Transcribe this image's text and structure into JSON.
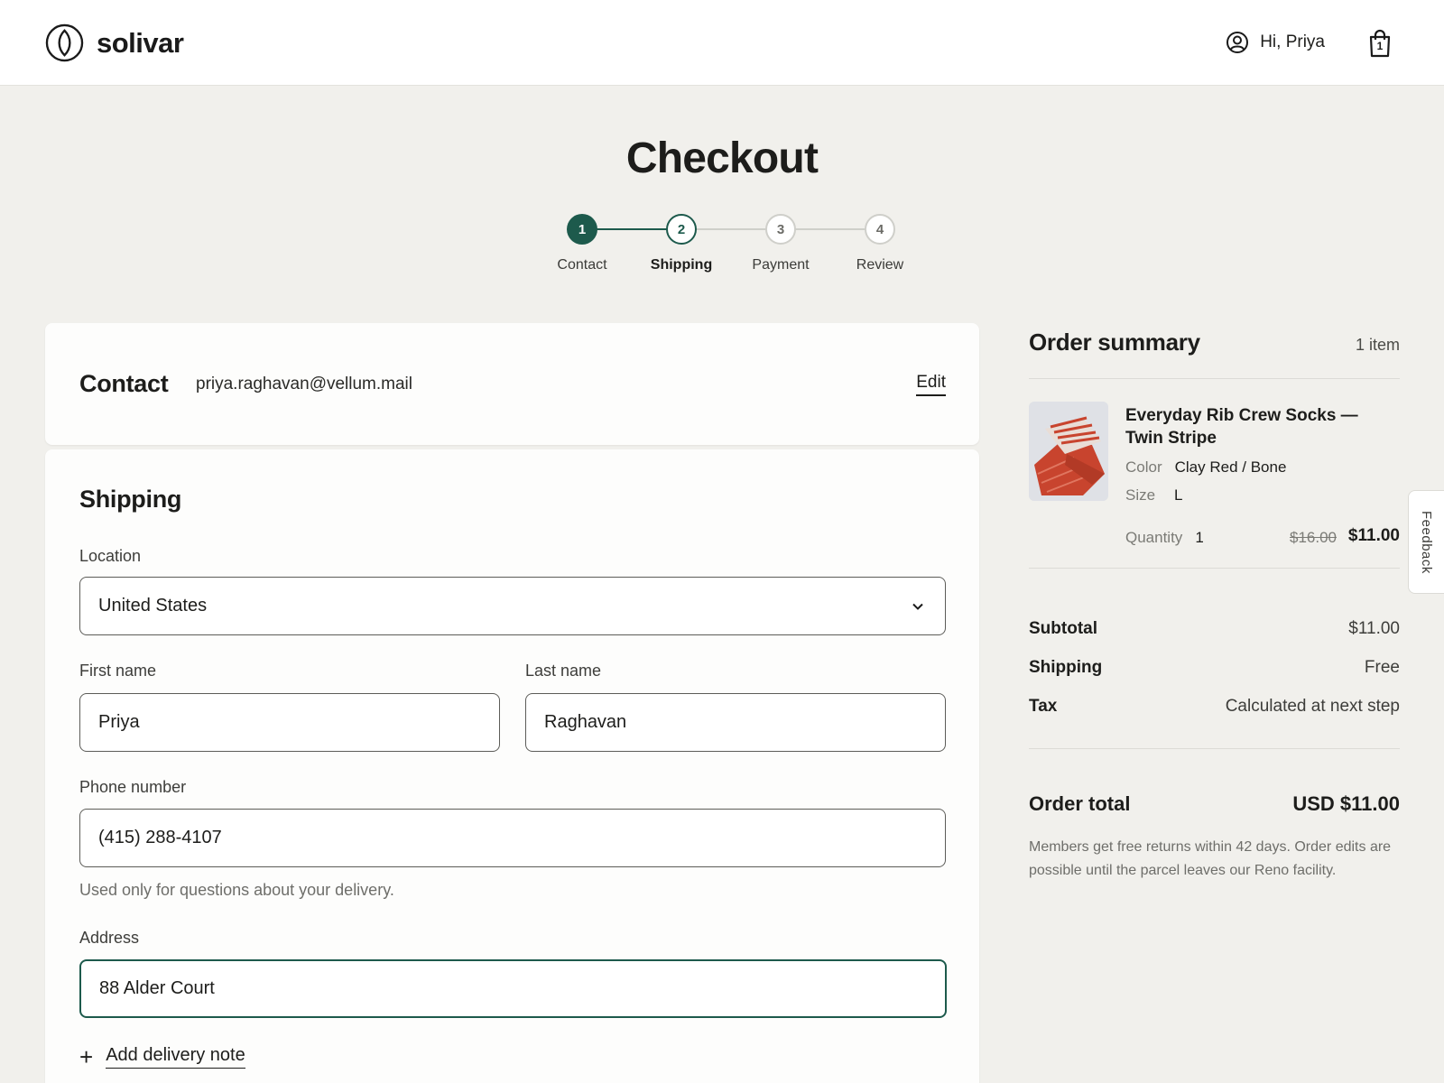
{
  "brand": {
    "name": "solivar",
    "accent": "#1d5a4c"
  },
  "header": {
    "greeting": "Hi, Priya",
    "cart_count": "1"
  },
  "page": {
    "title": "Checkout"
  },
  "stepper": {
    "current": 2,
    "steps": [
      {
        "number": "1",
        "label": "Contact",
        "state": "done"
      },
      {
        "number": "2",
        "label": "Shipping",
        "state": "active"
      },
      {
        "number": "3",
        "label": "Payment",
        "state": "todo"
      },
      {
        "number": "4",
        "label": "Review",
        "state": "todo"
      }
    ]
  },
  "contact": {
    "title": "Contact",
    "email": "priya.raghavan@vellum.mail",
    "edit_label": "Edit"
  },
  "shipping": {
    "title": "Shipping",
    "location": {
      "label": "Location",
      "value": "United States"
    },
    "first_name": {
      "label": "First name",
      "value": "Priya"
    },
    "last_name": {
      "label": "Last name",
      "value": "Raghavan"
    },
    "phone": {
      "label": "Phone number",
      "value": "(415) 288-4107",
      "help": "Used only for questions about your delivery."
    },
    "address": {
      "label": "Address",
      "value": "88 Alder Court"
    },
    "add_note_label": "Add delivery note"
  },
  "summary": {
    "title": "Order summary",
    "item_count": "1 item",
    "item": {
      "name": "Everyday Rib Crew Socks — Twin Stripe",
      "color_label": "Color",
      "color_value": "Clay Red / Bone",
      "size_label": "Size",
      "size_value": "L",
      "qty_label": "Quantity",
      "qty_value": "1",
      "price_original": "$16.00",
      "price_sale": "$11.00"
    },
    "subtotal": {
      "label": "Subtotal",
      "value": "$11.00"
    },
    "shipping": {
      "label": "Shipping",
      "value": "Free"
    },
    "tax": {
      "label": "Tax",
      "value": "Calculated at next step"
    },
    "order_total": {
      "label": "Order total",
      "value": "USD $11.00"
    },
    "note": "Members get free returns within 42 days. Order edits are possible until the parcel leaves our Reno facility."
  },
  "feedback": {
    "label": "Feedback"
  }
}
